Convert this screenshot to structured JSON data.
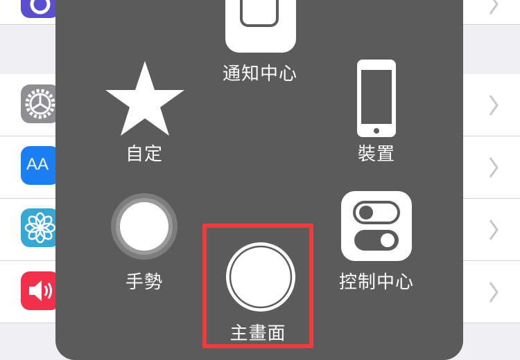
{
  "settings_list": {
    "chevron_icon": "chevron-right-icon",
    "rows": [
      {
        "icon": "siri-icon",
        "color": "#5a4fcf"
      },
      {
        "icon": "gear-icon",
        "color": "#8e8e93"
      },
      {
        "icon": "text-size-icon",
        "label": "AA",
        "color": "#1a7ef5"
      },
      {
        "icon": "wallpaper-flower-icon",
        "color": "#35a8d8"
      },
      {
        "icon": "speaker-icon",
        "color": "#f2304b"
      }
    ]
  },
  "assistive_touch_menu": {
    "items": [
      {
        "id": "notification-center",
        "label": "通知中心",
        "icon": "notification-center-icon"
      },
      {
        "id": "custom",
        "label": "自定",
        "icon": "star-icon"
      },
      {
        "id": "device",
        "label": "裝置",
        "icon": "iphone-icon"
      },
      {
        "id": "gestures",
        "label": "手勢",
        "icon": "gesture-circle-icon"
      },
      {
        "id": "home",
        "label": "主畫面",
        "icon": "home-button-icon"
      },
      {
        "id": "control-center",
        "label": "控制中心",
        "icon": "toggle-switches-icon"
      }
    ],
    "highlight_color": "#ef3b3b"
  }
}
